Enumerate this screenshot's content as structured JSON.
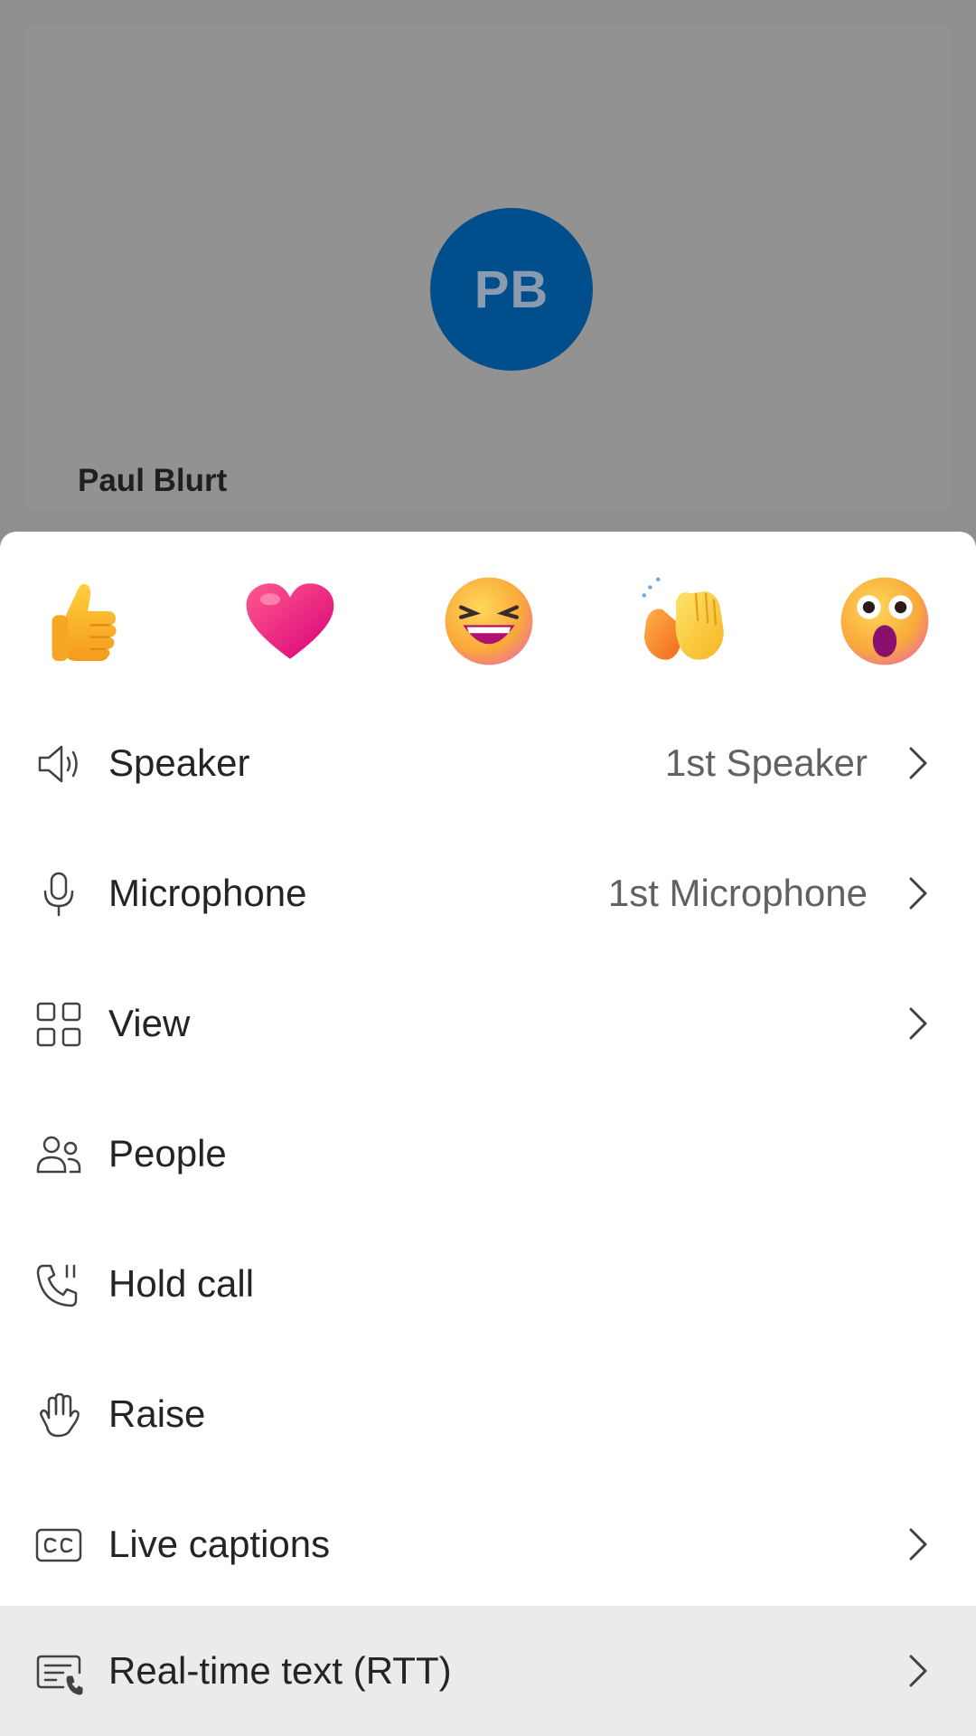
{
  "call": {
    "avatar_initials": "PB",
    "participant_name": "Paul Blurt",
    "avatar_color": "#004e8c"
  },
  "reactions": [
    {
      "name": "like",
      "icon": "thumbs-up-emoji"
    },
    {
      "name": "love",
      "icon": "heart-emoji"
    },
    {
      "name": "laugh",
      "icon": "laughing-face-emoji"
    },
    {
      "name": "applause",
      "icon": "clapping-hands-emoji"
    },
    {
      "name": "surprised",
      "icon": "surprised-face-emoji"
    }
  ],
  "menu": {
    "speaker": {
      "label": "Speaker",
      "value": "1st Speaker",
      "icon": "speaker-icon"
    },
    "microphone": {
      "label": "Microphone",
      "value": "1st Microphone",
      "icon": "microphone-icon"
    },
    "view": {
      "label": "View",
      "icon": "grid-view-icon"
    },
    "people": {
      "label": "People",
      "icon": "people-icon"
    },
    "hold_call": {
      "label": "Hold call",
      "icon": "phone-pause-icon"
    },
    "raise": {
      "label": "Raise",
      "icon": "hand-icon"
    },
    "live_captions": {
      "label": "Live captions",
      "icon": "closed-captions-icon"
    },
    "rtt": {
      "label": "Real-time text (RTT)",
      "icon": "rtt-icon"
    }
  }
}
